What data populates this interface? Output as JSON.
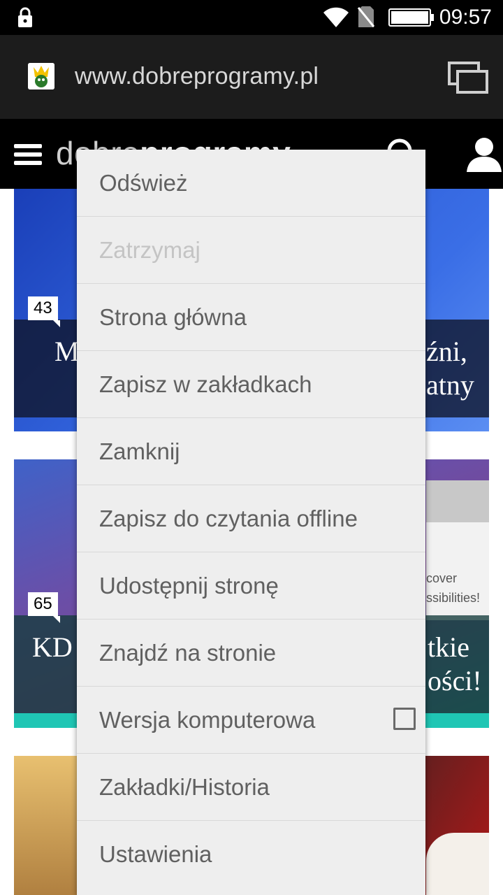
{
  "status_bar": {
    "time": "09:57",
    "icons": [
      "lock-icon",
      "wifi-icon",
      "no-sim-icon",
      "battery-icon"
    ]
  },
  "browser": {
    "url": "www.dobreprogramy.pl",
    "favicon": "dobreprogramy-favicon",
    "tabs_icon": "tabs-icon"
  },
  "site": {
    "logo_light": "dobre",
    "logo_bold": "programy",
    "menu_icon": "hamburger-icon",
    "search_icon": "search-icon",
    "user_icon": "user-icon"
  },
  "articles": [
    {
      "comments": "43",
      "title_left": "M",
      "title_right_1": "źni,",
      "title_right_2": "atny"
    },
    {
      "comments": "65",
      "title_left": "KD",
      "title_right_1": "tkie",
      "title_right_2": "ości!",
      "fragment_1": "cover",
      "fragment_2": "ssibilities!"
    },
    {}
  ],
  "menu": {
    "items": [
      {
        "label": "Odśwież",
        "enabled": true
      },
      {
        "label": "Zatrzymaj",
        "enabled": false
      },
      {
        "label": "Strona główna",
        "enabled": true
      },
      {
        "label": "Zapisz w zakładkach",
        "enabled": true
      },
      {
        "label": "Zamknij",
        "enabled": true
      },
      {
        "label": "Zapisz do czytania offline",
        "enabled": true
      },
      {
        "label": "Udostępnij stronę",
        "enabled": true
      },
      {
        "label": "Znajdź na stronie",
        "enabled": true
      },
      {
        "label": "Wersja komputerowa",
        "enabled": true,
        "checkbox": false
      },
      {
        "label": "Zakładki/Historia",
        "enabled": true
      },
      {
        "label": "Ustawienia",
        "enabled": true
      }
    ]
  },
  "colors": {
    "menu_bg": "#eeeeee",
    "menu_text": "#606060",
    "menu_disabled": "#c4c4c4"
  }
}
